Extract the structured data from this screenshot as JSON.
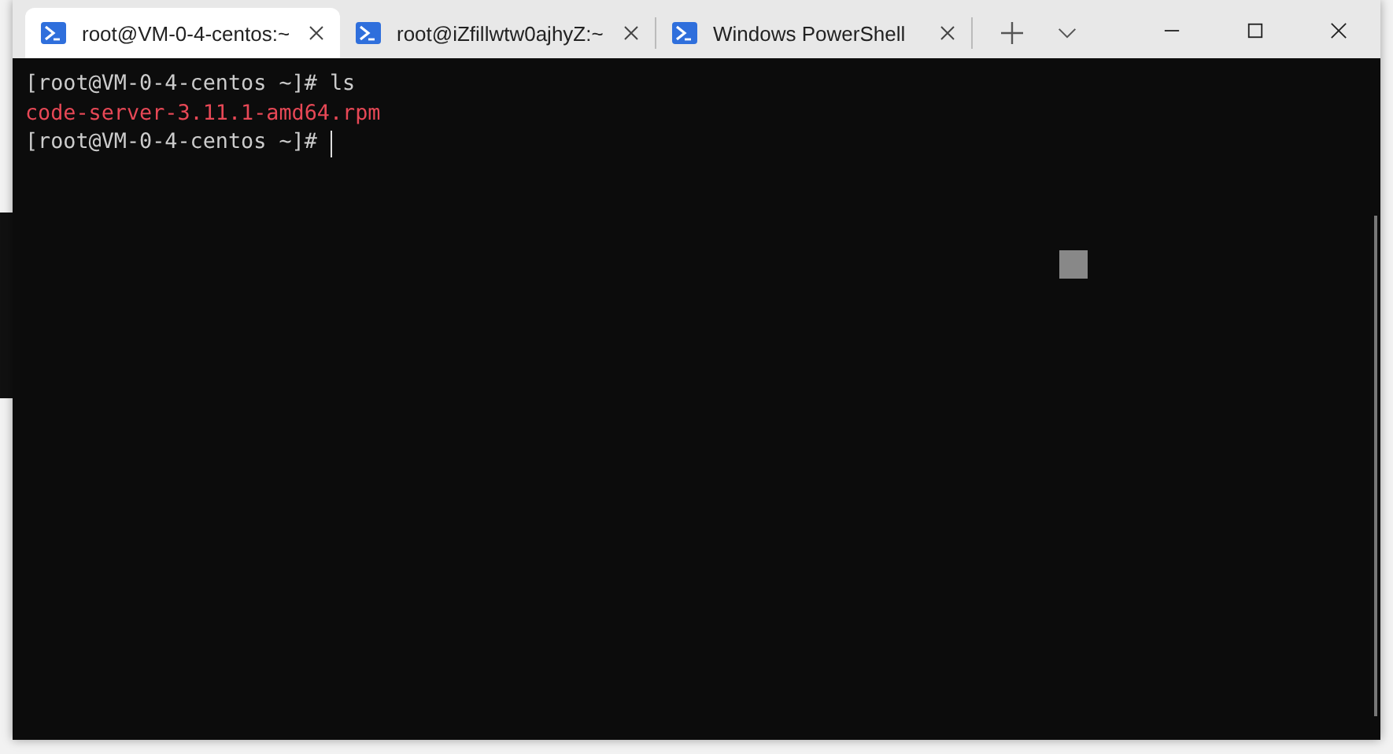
{
  "tabs": [
    {
      "title": "root@VM-0-4-centos:~",
      "selected": true
    },
    {
      "title": "root@iZfillwtw0ajhyZ:~",
      "selected": false
    },
    {
      "title": "Windows PowerShell",
      "selected": false
    }
  ],
  "terminal": {
    "lines": [
      {
        "text": "[root@VM-0-4-centos ~]# ls",
        "kind": "input",
        "cursor": false
      },
      {
        "text": "code-server-3.11.1-amd64.rpm",
        "kind": "file",
        "cursor": false
      },
      {
        "text": "[root@VM-0-4-centos ~]#",
        "kind": "input",
        "cursor": true
      }
    ]
  }
}
